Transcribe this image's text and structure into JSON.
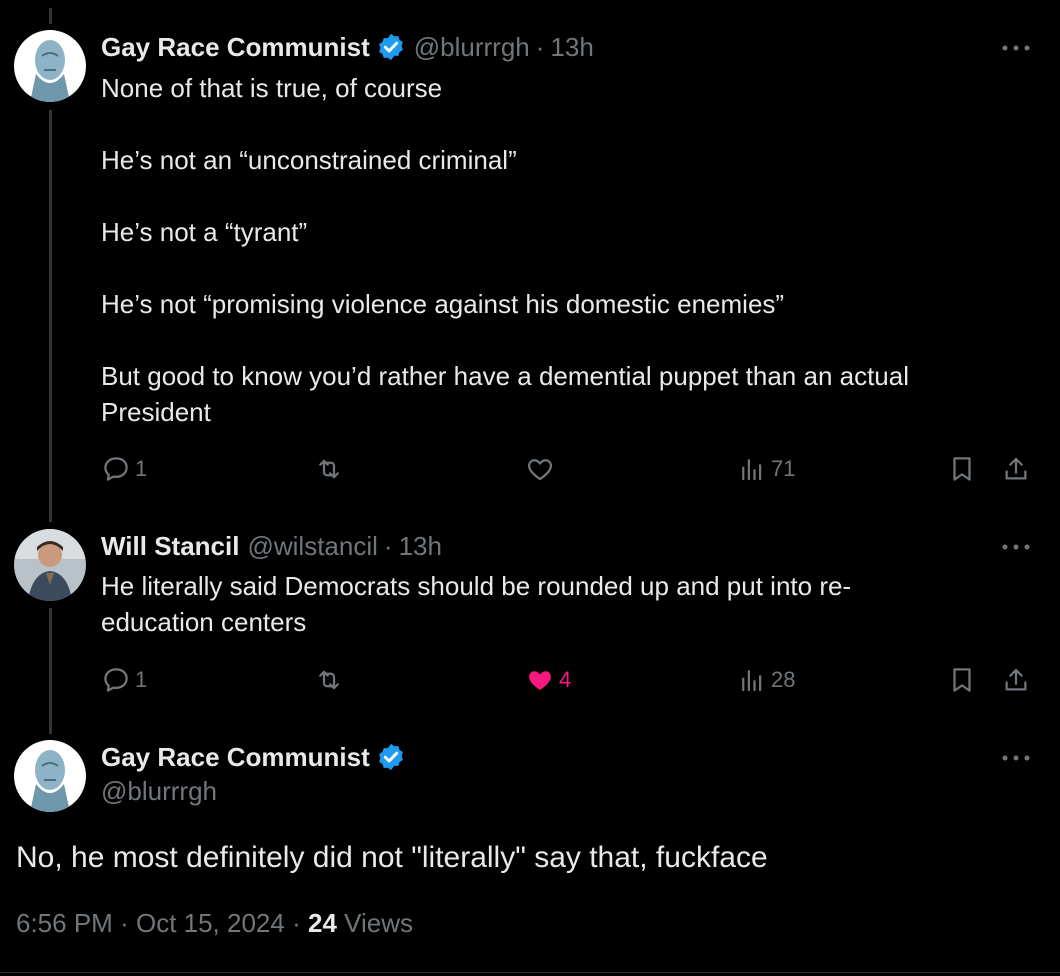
{
  "tweets": [
    {
      "author": {
        "name": "Gay Race Communist",
        "handle": "@blurrrgh",
        "verified": true,
        "avatar_icon": "grey-statue-avatar"
      },
      "separator": "·",
      "time": "13h",
      "text": "None of that is true, of course\n\nHe’s not an “unconstrained criminal”\n\nHe’s not a “tyrant”\n\nHe’s not “promising violence against his domestic enemies”\n\nBut good to know you’d rather have a demential puppet than an actual President",
      "actions": {
        "replies": "1",
        "reposts": "",
        "likes": "",
        "views": "71",
        "liked": false
      }
    },
    {
      "author": {
        "name": "Will Stancil",
        "handle": "@wilstancil",
        "verified": false,
        "avatar_icon": "person-photo-avatar"
      },
      "separator": "·",
      "time": "13h",
      "text": "He literally said Democrats should be rounded up and put into re-\neducation centers",
      "actions": {
        "replies": "1",
        "reposts": "",
        "likes": "4",
        "views": "28",
        "liked": true
      }
    }
  ],
  "focused_tweet": {
    "author": {
      "name": "Gay Race Communist",
      "handle": "@blurrrgh",
      "verified": true,
      "avatar_icon": "grey-statue-avatar"
    },
    "text": "No, he most definitely did not \"literally\" say that, fuckface",
    "time": "6:56 PM",
    "separator1": "·",
    "date": "Oct 15, 2024",
    "separator2": "·",
    "views_count": "24",
    "views_label": "Views"
  },
  "colors": {
    "background": "#000000",
    "text": "#e7e9ea",
    "muted": "#71767b",
    "like": "#f91880",
    "verified": "#1d9bf0",
    "thread_line": "#333639"
  }
}
